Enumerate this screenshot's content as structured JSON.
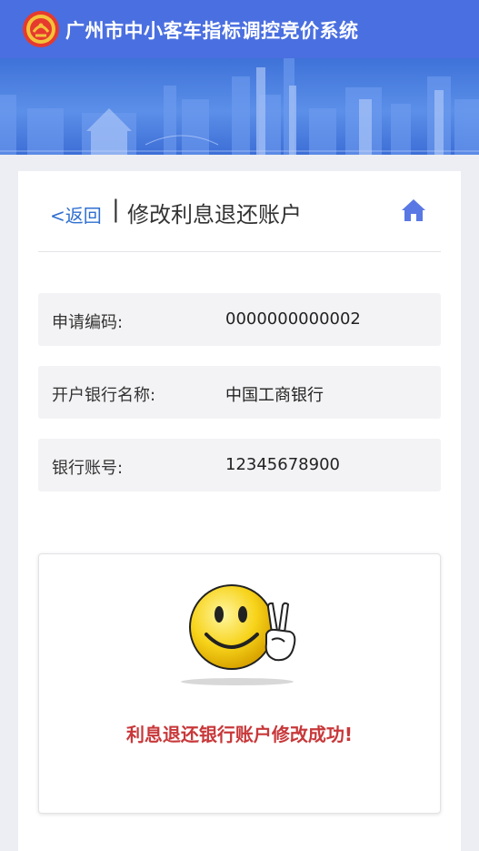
{
  "header": {
    "title": "广州市中小客车指标调控竞价系统",
    "logo_icon": "guangzhou-emblem-icon",
    "background": "#4a6fe0"
  },
  "banner": {
    "image": "city-skyline-banner"
  },
  "topbar": {
    "back_label": "<返回",
    "separator": "|",
    "page_title": "修改利息退还账户",
    "home_icon": "home-icon"
  },
  "fields": [
    {
      "label": "申请编码:",
      "value": "0000000000002"
    },
    {
      "label": "开户银行名称:",
      "value": "中国工商银行"
    },
    {
      "label": "银行账号:",
      "value": "12345678900"
    }
  ],
  "result": {
    "icon": "smiley-victory-icon",
    "message": "利息退还银行账户修改成功!",
    "message_color": "#c8383a"
  }
}
